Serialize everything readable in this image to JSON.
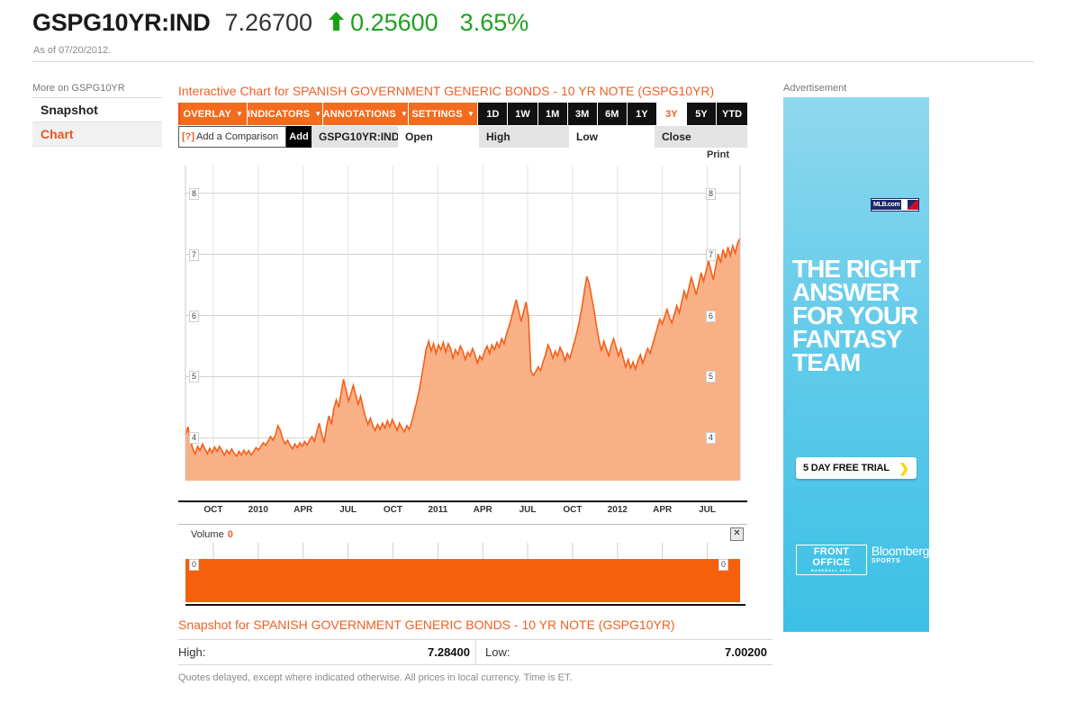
{
  "header": {
    "ticker": "GSPG10YR:IND",
    "last_price": "7.26700",
    "arrow": "up-arrow-icon",
    "change_abs": "0.25600",
    "change_pct": "3.65%",
    "as_of": "As of 07/20/2012.",
    "up_color": "#20a020"
  },
  "sidebar": {
    "title": "More on GSPG10YR",
    "items": [
      {
        "label": "Snapshot",
        "active": false
      },
      {
        "label": "Chart",
        "active": true
      }
    ]
  },
  "chart_panel": {
    "title": "Interactive Chart for SPANISH GOVERNMENT GENERIC BONDS - 10 YR NOTE (GSPG10YR)",
    "menus": [
      {
        "label": "OVERLAY",
        "caret": "▼"
      },
      {
        "label": "INDICATORS",
        "caret": "▼"
      },
      {
        "label": "ANNOTATIONS",
        "caret": "▼"
      },
      {
        "label": "SETTINGS",
        "caret": "▼"
      }
    ],
    "ranges": [
      {
        "label": "1D",
        "active": false
      },
      {
        "label": "1W",
        "active": false
      },
      {
        "label": "1M",
        "active": false
      },
      {
        "label": "3M",
        "active": false
      },
      {
        "label": "6M",
        "active": false
      },
      {
        "label": "1Y",
        "active": false
      },
      {
        "label": "3Y",
        "active": true
      },
      {
        "label": "5Y",
        "active": false
      },
      {
        "label": "YTD",
        "active": false
      }
    ],
    "comparison": {
      "help_marker": "[?]",
      "placeholder": "Add a Comparison",
      "value": "Add a Comparison",
      "add_label": "Add"
    },
    "ohlc_fields": [
      {
        "label": "GSPG10YR:IND",
        "shade": "gray"
      },
      {
        "label": "Open",
        "shade": "white"
      },
      {
        "label": "High",
        "shade": "gray"
      },
      {
        "label": "Low",
        "shade": "white"
      },
      {
        "label": "Close",
        "shade": "gray"
      }
    ],
    "print_label": "Print",
    "volume": {
      "label": "Volume",
      "value": "0",
      "axis_labels": [
        "0",
        "0"
      ],
      "close_icon": "☒"
    }
  },
  "chart_data": {
    "type": "area",
    "title": "Interactive Chart for SPANISH GOVERNMENT GENERIC BONDS - 10 YR NOTE (GSPG10YR)",
    "xlabel": "",
    "ylabel": "",
    "ylim": [
      3.3,
      8.45
    ],
    "xlim": [
      "2009-07",
      "2012-07"
    ],
    "grid": true,
    "legend": "none",
    "line_color": "#f4601a",
    "fill_color": "#f9b087",
    "y_ticks": [
      8,
      7,
      6,
      5,
      4
    ],
    "y_tick_labels": [
      "8",
      "7",
      "6",
      "5",
      "4"
    ],
    "x_tick_labels": [
      "OCT",
      "2010",
      "APR",
      "JUL",
      "OCT",
      "2011",
      "APR",
      "JUL",
      "OCT",
      "2012",
      "APR",
      "JUL"
    ],
    "series": [
      {
        "name": "GSPG10YR:IND",
        "values": [
          4.05,
          4.18,
          3.98,
          3.82,
          3.74,
          3.86,
          3.79,
          3.9,
          3.82,
          3.74,
          3.83,
          3.76,
          3.85,
          3.78,
          3.86,
          3.79,
          3.72,
          3.8,
          3.74,
          3.82,
          3.75,
          3.7,
          3.78,
          3.72,
          3.8,
          3.73,
          3.79,
          3.72,
          3.78,
          3.84,
          3.8,
          3.86,
          3.92,
          3.88,
          3.95,
          4.02,
          3.96,
          4.05,
          4.2,
          4.12,
          3.98,
          3.9,
          3.96,
          3.88,
          3.82,
          3.9,
          3.84,
          3.92,
          3.86,
          3.94,
          3.88,
          3.96,
          4.02,
          3.94,
          4.1,
          4.24,
          4.06,
          3.92,
          4.18,
          4.36,
          4.22,
          4.48,
          4.62,
          4.5,
          4.74,
          4.96,
          4.78,
          4.6,
          4.72,
          4.86,
          4.7,
          4.55,
          4.68,
          4.5,
          4.34,
          4.22,
          4.32,
          4.2,
          4.12,
          4.22,
          4.14,
          4.24,
          4.16,
          4.28,
          4.18,
          4.3,
          4.22,
          4.12,
          4.24,
          4.16,
          4.1,
          4.2,
          4.14,
          4.26,
          4.42,
          4.58,
          4.76,
          4.98,
          5.22,
          5.46,
          5.58,
          5.42,
          5.54,
          5.38,
          5.52,
          5.44,
          5.56,
          5.4,
          5.54,
          5.46,
          5.3,
          5.44,
          5.36,
          5.5,
          5.42,
          5.28,
          5.4,
          5.34,
          5.46,
          5.36,
          5.22,
          5.34,
          5.28,
          5.42,
          5.5,
          5.38,
          5.52,
          5.44,
          5.56,
          5.48,
          5.62,
          5.54,
          5.7,
          5.82,
          5.96,
          6.12,
          6.26,
          6.08,
          5.9,
          6.06,
          6.22,
          5.98,
          5.1,
          5.02,
          5.08,
          5.16,
          5.1,
          5.24,
          5.36,
          5.52,
          5.44,
          5.3,
          5.42,
          5.34,
          5.48,
          5.4,
          5.26,
          5.38,
          5.3,
          5.44,
          5.58,
          5.74,
          5.92,
          6.14,
          6.4,
          6.64,
          6.52,
          6.3,
          6.08,
          5.82,
          5.6,
          5.42,
          5.58,
          5.46,
          5.34,
          5.5,
          5.62,
          5.48,
          5.34,
          5.46,
          5.3,
          5.16,
          5.28,
          5.14,
          5.24,
          5.12,
          5.26,
          5.36,
          5.22,
          5.34,
          5.46,
          5.38,
          5.52,
          5.66,
          5.8,
          5.94,
          5.86,
          5.98,
          6.1,
          5.96,
          5.88,
          6.02,
          6.16,
          6.04,
          6.22,
          6.4,
          6.28,
          6.46,
          6.62,
          6.48,
          6.34,
          6.52,
          6.7,
          6.56,
          6.72,
          6.9,
          6.74,
          6.58,
          6.8,
          7.0,
          6.86,
          7.08,
          6.94,
          7.12,
          6.98,
          7.14,
          7.02,
          7.18,
          7.267
        ]
      }
    ],
    "volume_series": {
      "name": "Volume",
      "value": 0,
      "axis_labels": [
        "0",
        "0"
      ]
    }
  },
  "snapshot": {
    "title": "Snapshot for SPANISH GOVERNMENT GENERIC BONDS - 10 YR NOTE (GSPG10YR)",
    "rows": [
      {
        "key": "High:",
        "value": "7.28400"
      },
      {
        "key": "Low:",
        "value": "7.00200"
      }
    ],
    "disclaimer": "Quotes delayed, except where indicated otherwise. All prices in local currency. Time is ET."
  },
  "ad": {
    "label": "Advertisement",
    "brand_logo": "MLB.com",
    "headline": [
      "THE RIGHT",
      "ANSWER",
      "FOR YOUR",
      "FANTASY",
      "TEAM"
    ],
    "cta": "5 DAY FREE TRIAL",
    "cta_arrow": "❯",
    "footer_logo_1": "FRONT OFFICE",
    "footer_logo_1_sub": "BASEBALL 2012",
    "footer_logo_2": "Bloomberg",
    "footer_logo_2_sub": "SPORTS"
  }
}
